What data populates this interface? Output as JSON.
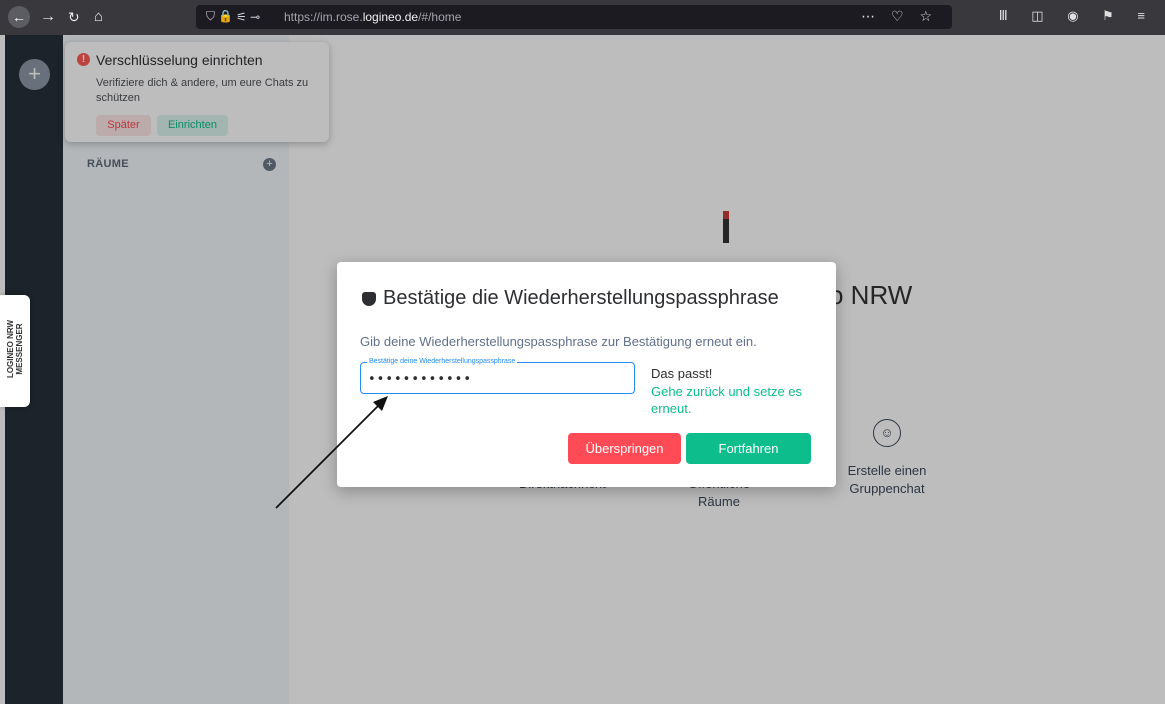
{
  "browser": {
    "url_host": "https://im.rose.",
    "url_domain": "logineo.de",
    "url_path": "/#/home"
  },
  "toast": {
    "title": "Verschlüsselung einrichten",
    "body": "Verifiziere dich & andere, um eure Chats zu schützen",
    "later_label": "Später",
    "setup_label": "Einrichten"
  },
  "sidebar": {
    "rooms_label": "RÄUME"
  },
  "sidetab": {
    "label": "LOGINEO NRW MESSENGER"
  },
  "main": {
    "welcome_fragment": "o NRW",
    "actions": [
      {
        "label": "Direktnachricht"
      },
      {
        "label": "Öffentliche Räume"
      },
      {
        "label": "Erstelle einen Gruppenchat"
      }
    ]
  },
  "dialog": {
    "title": "Bestätige die Wiederherstellungspassphrase",
    "description": "Gib deine Wiederherstellungspassphrase zur Bestätigung erneut ein.",
    "field_label": "Bestätige deine Wiederherstellungspassphrase",
    "field_value": "••••••••••••",
    "match_text": "Das passt!",
    "reset_link": "Gehe zurück und setze es erneut.",
    "skip_label": "Überspringen",
    "continue_label": "Fortfahren"
  },
  "colors": {
    "accent_green": "#0dbd8b",
    "alert_red": "#ff4b55",
    "focus_blue": "#238cf5"
  }
}
